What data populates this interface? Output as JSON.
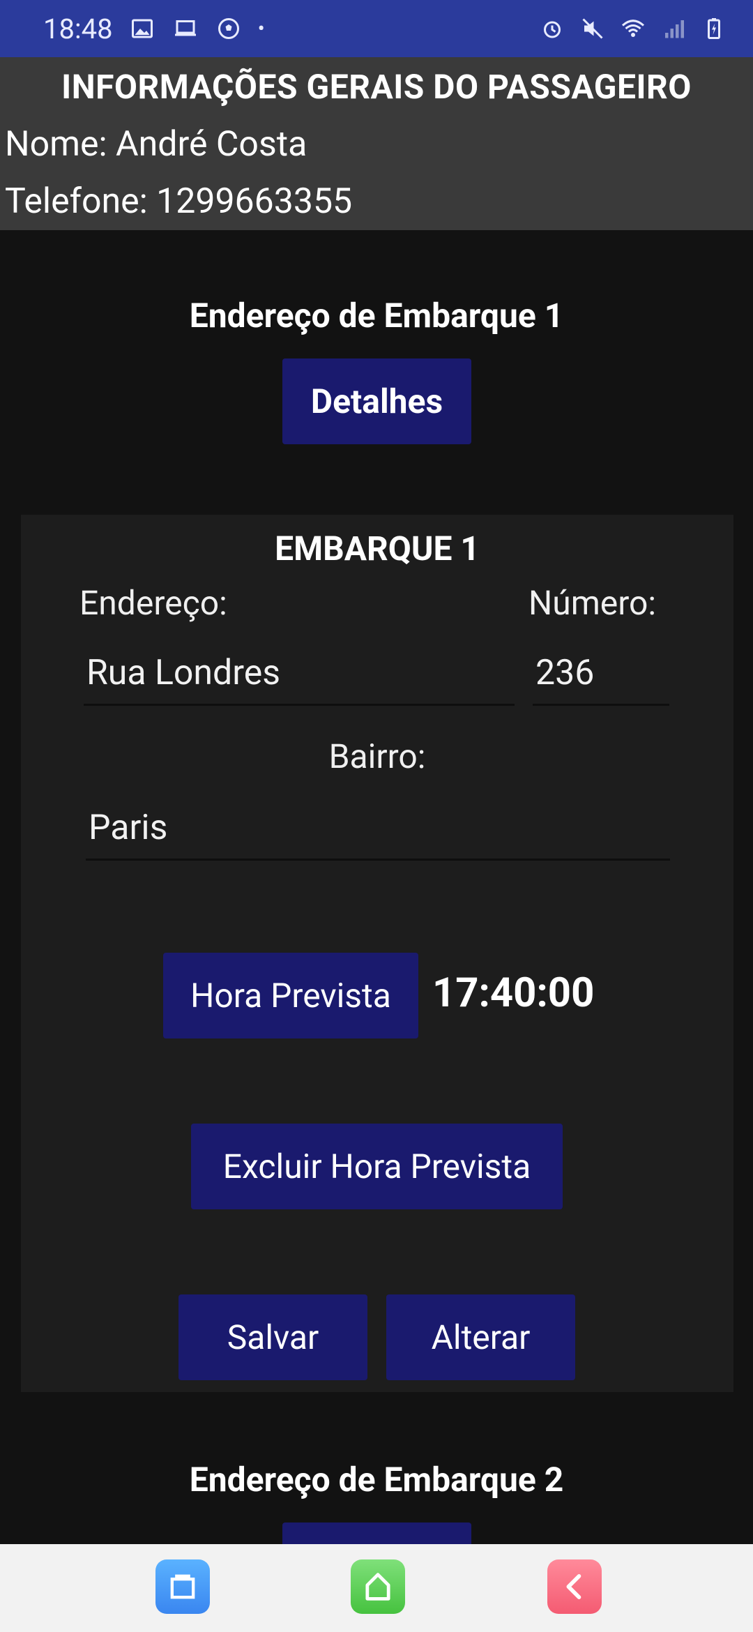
{
  "status_bar": {
    "time": "18:48",
    "dot": "•",
    "left_icons": [
      "image-icon",
      "laptop-icon",
      "soccer-icon"
    ],
    "right_icons": [
      "alarm-icon",
      "mute-icon",
      "wifi-icon",
      "signal-icon",
      "battery-icon"
    ]
  },
  "header": {
    "title": "INFORMAÇÕES GERAIS DO PASSAGEIRO",
    "name_line": "Nome: André Costa",
    "phone_line": "Telefone: 1299663355"
  },
  "section1": {
    "title": "Endereço de Embarque 1",
    "details_button": "Detalhes"
  },
  "card": {
    "title": "EMBARQUE 1",
    "address_label": "Endereço:",
    "number_label": "Número:",
    "address_value": "Rua Londres",
    "number_value": "236",
    "neighborhood_label": "Bairro:",
    "neighborhood_value": "Paris",
    "time_button": "Hora Prevista",
    "time_value": "17:40:00",
    "delete_time_button": "Excluir Hora Prevista",
    "save_button": "Salvar",
    "edit_button": "Alterar"
  },
  "section2": {
    "title": "Endereço de Embarque 2"
  },
  "colors": {
    "status_bar": "#2b3b9c",
    "button": "#1a1a6e",
    "info_panel": "#3a3a3a",
    "card": "#1d1d1d",
    "background": "#121212"
  }
}
